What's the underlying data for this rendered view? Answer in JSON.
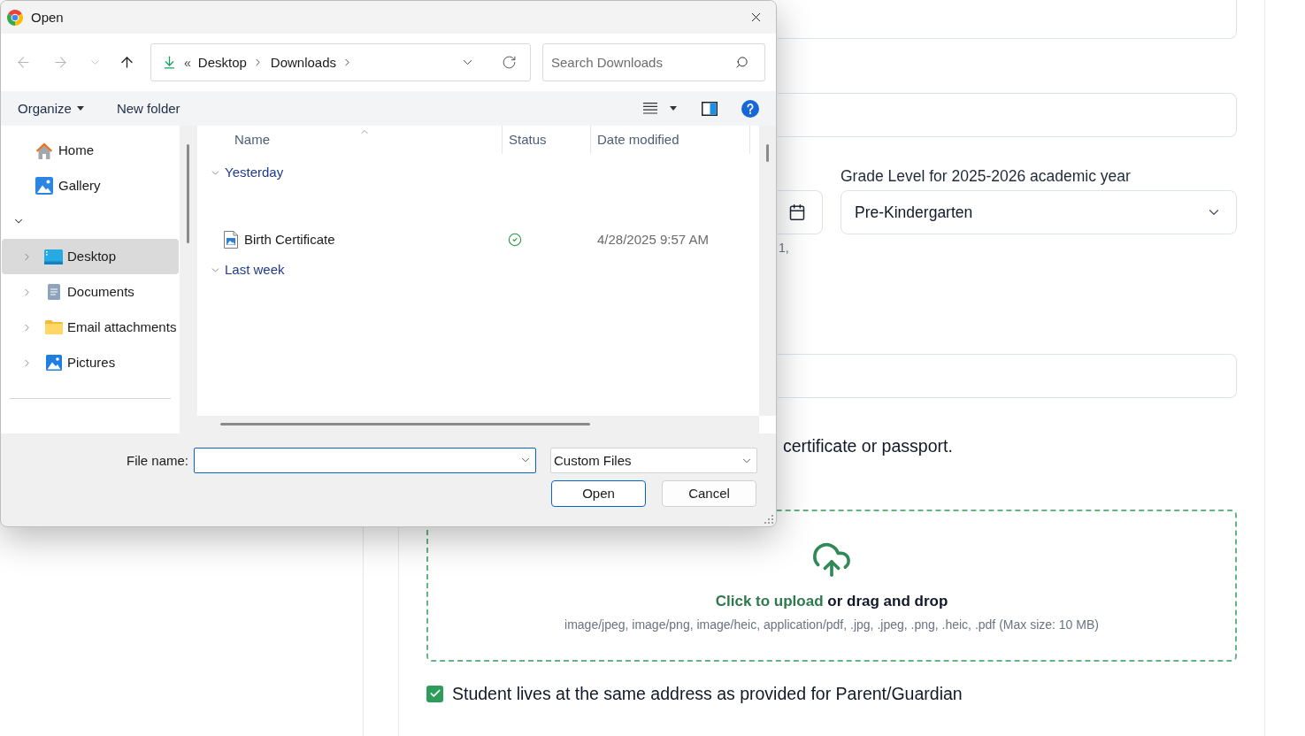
{
  "dialog": {
    "title": "Open",
    "nav_buttons": [
      {
        "kind": "back",
        "disabled": true
      },
      {
        "kind": "forward",
        "disabled": true
      },
      {
        "kind": "recent",
        "disabled": true
      },
      {
        "kind": "up",
        "disabled": false
      }
    ],
    "address": {
      "overflow_marker": "«",
      "path": [
        "Desktop",
        "Downloads"
      ]
    },
    "search": {
      "placeholder": "Search Downloads"
    },
    "toolbar": [
      {
        "label": "Organize",
        "kind": "menu"
      },
      {
        "label": "New folder",
        "kind": "button"
      }
    ],
    "nav_pane": {
      "items": [
        {
          "label": "Home",
          "kind": "home",
          "selected": false
        },
        {
          "label": "Gallery",
          "kind": "gallery",
          "selected": false
        }
      ],
      "section": {
        "expanded": true,
        "items": [
          {
            "label": "Desktop",
            "kind": "desktop",
            "selected": true,
            "expanded": false
          },
          {
            "label": "Documents",
            "kind": "documents",
            "selected": false,
            "expanded": false
          },
          {
            "label": "Email attachments",
            "kind": "folder",
            "selected": false,
            "expanded": false
          },
          {
            "label": "Pictures",
            "kind": "pictures",
            "selected": false,
            "expanded": false
          }
        ]
      }
    },
    "file_list": {
      "columns": [
        {
          "label": "Name",
          "sorted": true
        },
        {
          "label": "Status",
          "sorted": false
        },
        {
          "label": "Date modified",
          "sorted": false
        }
      ],
      "groups": [
        {
          "label": "Yesterday",
          "expanded": true,
          "files": [
            {
              "name": "Birth Certificate",
              "kind": "image",
              "synced": true,
              "date_modified": "4/28/2025 9:57 AM"
            }
          ]
        },
        {
          "label": "Last week",
          "expanded": true
        }
      ]
    },
    "file_name": {
      "label": "File name:",
      "focused": true
    },
    "file_type": {
      "value": "Custom Files"
    },
    "buttons": [
      {
        "label": "Open",
        "default": true
      },
      {
        "label": "Cancel",
        "default": false
      }
    ]
  },
  "form": {
    "grade": {
      "label": "Grade Level for 2025-2026 academic year",
      "value": "Pre-Kindergarten"
    },
    "date_hint": "1,",
    "document_hint": "certificate or passport.",
    "upload": {
      "link": "Click to upload",
      "text": "or drag and drop",
      "types": "image/jpeg, image/png, image/heic, application/pdf, .jpg, .jpeg, .png, .heic, .pdf (Max size: 10 MB)"
    },
    "same_address": {
      "label": "Student lives at the same address as provided for Parent/Guardian",
      "checked": true
    }
  }
}
